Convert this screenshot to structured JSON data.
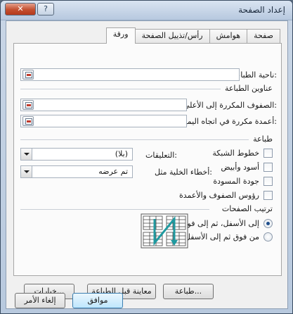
{
  "window": {
    "title": "إعداد الصفحة",
    "close_glyph": "✕",
    "help_glyph": "?"
  },
  "tabs": [
    {
      "label": "صفحة"
    },
    {
      "label": "هوامش"
    },
    {
      "label": "رأس/تذييل الصفحة"
    },
    {
      "label": "ورقة"
    }
  ],
  "sheet": {
    "print_area_label": "ناحية الطباعة:",
    "print_titles_label": "عناوين الطباعة",
    "rows_repeat_label": "الصفوف المكررة إلى الأعلى:",
    "cols_repeat_label": "أعمدة مكررة في اتجاه اليمين:",
    "print_group_label": "طباعة",
    "checkboxes": [
      {
        "label": "خطوط الشبكة",
        "checked": false
      },
      {
        "label": "أسود وأبيض",
        "checked": false
      },
      {
        "label": "جودة المسودة",
        "checked": false
      },
      {
        "label": "رؤوس الصفوف والأعمدة",
        "checked": false
      }
    ],
    "comments_label": "التعليقات:",
    "comments_value": "(بلا)",
    "errors_label": "أخطاء الخلية مثل:",
    "errors_value": "تم عرضه",
    "page_order_label": "ترتيب الصفحات",
    "radios": [
      {
        "label": "إلى الأسفل، ثم إلى فوق",
        "selected": true
      },
      {
        "label": "من فوق ثم إلى الأسفل",
        "selected": false
      }
    ]
  },
  "buttons": {
    "print": "طباعة...",
    "print_preview": "معاينة قبل الطباعة",
    "options": "خيارات...",
    "ok": "موافق",
    "cancel": "إلغاء الأمر"
  },
  "colors": {
    "accent_arrow": "#1f9aa0",
    "default_button": "#3c7fb1"
  }
}
